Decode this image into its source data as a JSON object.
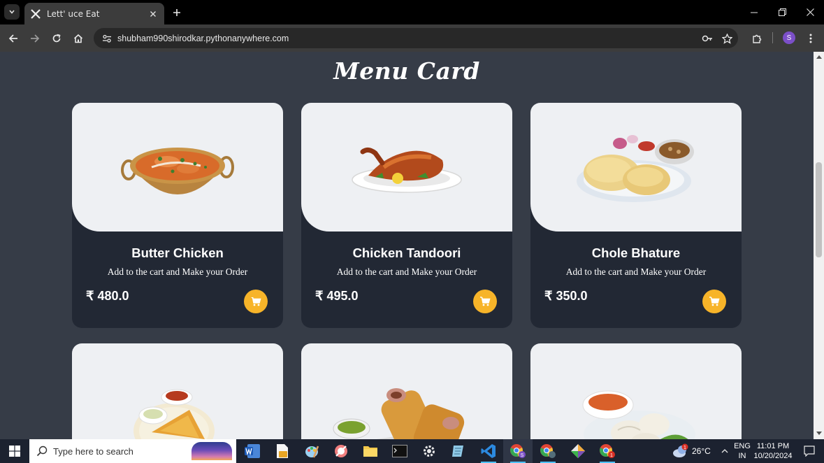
{
  "browser": {
    "tab_title": "Lett' uce Eat",
    "url": "shubham990shirodkar.pythonanywhere.com",
    "profile_initial": "S"
  },
  "page": {
    "title": "Menu Card",
    "items": [
      {
        "name": "Butter Chicken",
        "description": "Add to the cart and Make your Order",
        "price": "₹ 480.0",
        "image": "butter-chicken-image"
      },
      {
        "name": "Chicken Tandoori",
        "description": "Add to the cart and Make your Order",
        "price": "₹ 495.0",
        "image": "chicken-tandoori-image"
      },
      {
        "name": "Chole Bhature",
        "description": "Add to the cart and Make your Order",
        "price": "₹ 350.0",
        "image": "chole-bhature-image"
      },
      {
        "image": "dosa-image"
      },
      {
        "image": "wrap-roll-image"
      },
      {
        "image": "momos-image"
      }
    ],
    "accent_color": "#f7b429",
    "background_color": "#363c47",
    "card_color": "#222834"
  },
  "taskbar": {
    "search_placeholder": "Type here to search",
    "weather": "26°C",
    "language": "ENG",
    "region": "IN",
    "time": "11:01 PM",
    "date": "10/20/2024",
    "weather_badge": "1",
    "chrome_badge": "1"
  }
}
